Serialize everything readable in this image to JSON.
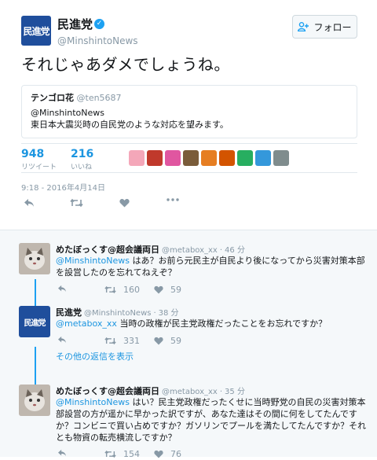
{
  "tweet": {
    "logo_text": "民進党",
    "author_name": "民進党",
    "author_handle": "@MinshintoNews",
    "follow_label": "フォロー",
    "text": "それじゃあダメでしょうね。",
    "quote": {
      "name": "テンゴロ花",
      "handle": "@ten5687",
      "line1": "@MinshintoNews",
      "line2": "東日本大震災時の自民党のような対応を望みます。"
    },
    "retweets": {
      "count": "948",
      "label": "リツイート"
    },
    "likes": {
      "count": "216",
      "label": "いいね"
    },
    "liker_avatar_colors": [
      "#f4a7b9",
      "#c0392b",
      "#e056a0",
      "#7a5c3a",
      "#e67e22",
      "#d35400",
      "#27ae60",
      "#3498db",
      "#7f8c8d"
    ],
    "timestamp": "9:18 - 2016年4月14日"
  },
  "replies": [
    {
      "name": "めたぼっくす@超会議両日",
      "handle": "@metabox_xx",
      "age": "46 分",
      "mention": "@MinshintoNews",
      "text": " はあ？お前ら元民主が自民より後になってから災害対策本部を設営したのを忘れてねえぞ？",
      "retweets": "160",
      "likes": "59"
    },
    {
      "logo_text": "民進党",
      "name": "民進党",
      "handle": "@MinshintoNews",
      "age": "38 分",
      "mention": "@metabox_xx",
      "text": " 当時の政権が民主党政権だったことをお忘れですか？",
      "retweets": "331",
      "likes": "59"
    },
    {
      "name": "めたぼっくす@超会議両日",
      "handle": "@metabox_xx",
      "age": "35 分",
      "mention": "@MinshintoNews",
      "text": " はい？民主党政権だったくせに当時野党の自民の災害対策本部設営の方が遥かに早かった訳ですが、あなた達はその間に何をしてたんですか？コンビニで買い占めですか？ガソリンでプールを満たしてたんですか？それとも物資の転売横流しですか？",
      "retweets": "154",
      "likes": "76"
    }
  ],
  "more_replies_label": "その他の返信を表示",
  "colors": {
    "accent": "#1b95e0",
    "brand": "#1f4e9c",
    "muted": "#8899a6"
  }
}
